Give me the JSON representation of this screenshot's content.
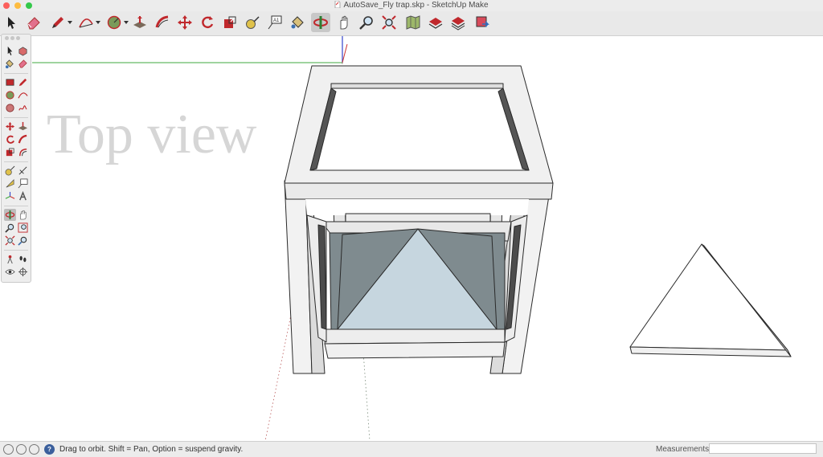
{
  "window": {
    "title": "AutoSave_Fly trap.skp - SketchUp Make",
    "traffic_lights": {
      "close": "#fc605c",
      "minimize": "#fdbc40",
      "zoom": "#34c84a"
    }
  },
  "toolbar": {
    "items": [
      {
        "name": "select-tool",
        "icon": "arrow-cursor-icon"
      },
      {
        "name": "eraser-tool",
        "icon": "eraser-icon"
      },
      {
        "name": "pencil-tool",
        "icon": "pencil-icon",
        "dropdown": true
      },
      {
        "name": "arc-tool",
        "icon": "arc-icon",
        "dropdown": true
      },
      {
        "name": "shapes-tool",
        "icon": "circle-icon",
        "dropdown": true
      },
      {
        "name": "push-pull-tool",
        "icon": "push-pull-icon"
      },
      {
        "name": "offset-tool",
        "icon": "follow-me-icon"
      },
      {
        "name": "move-tool",
        "icon": "move-arrows-icon"
      },
      {
        "name": "rotate-tool",
        "icon": "rotate-icon"
      },
      {
        "name": "scale-tool",
        "icon": "scale-icon"
      },
      {
        "name": "tape-measure-tool",
        "icon": "tape-measure-icon"
      },
      {
        "name": "text-tool",
        "icon": "text-label-icon"
      },
      {
        "name": "paint-bucket-tool",
        "icon": "paint-bucket-icon"
      },
      {
        "name": "orbit-tool",
        "icon": "orbit-icon",
        "active": true
      },
      {
        "name": "pan-tool",
        "icon": "hand-icon"
      },
      {
        "name": "zoom-tool",
        "icon": "magnifier-icon"
      },
      {
        "name": "zoom-extents-tool",
        "icon": "zoom-extents-icon"
      },
      {
        "name": "warehouse-tool",
        "icon": "map-icon"
      },
      {
        "name": "share-model-tool",
        "icon": "warehouse-icon"
      },
      {
        "name": "share-component-tool",
        "icon": "component-icon"
      },
      {
        "name": "extension-tool",
        "icon": "extension-icon"
      }
    ]
  },
  "viewport": {
    "scene_label": "Top view"
  },
  "status": {
    "hint": "Drag to orbit. Shift = Pan, Option = suspend gravity.",
    "measurements_label": "Measurements",
    "measurements_value": ""
  }
}
